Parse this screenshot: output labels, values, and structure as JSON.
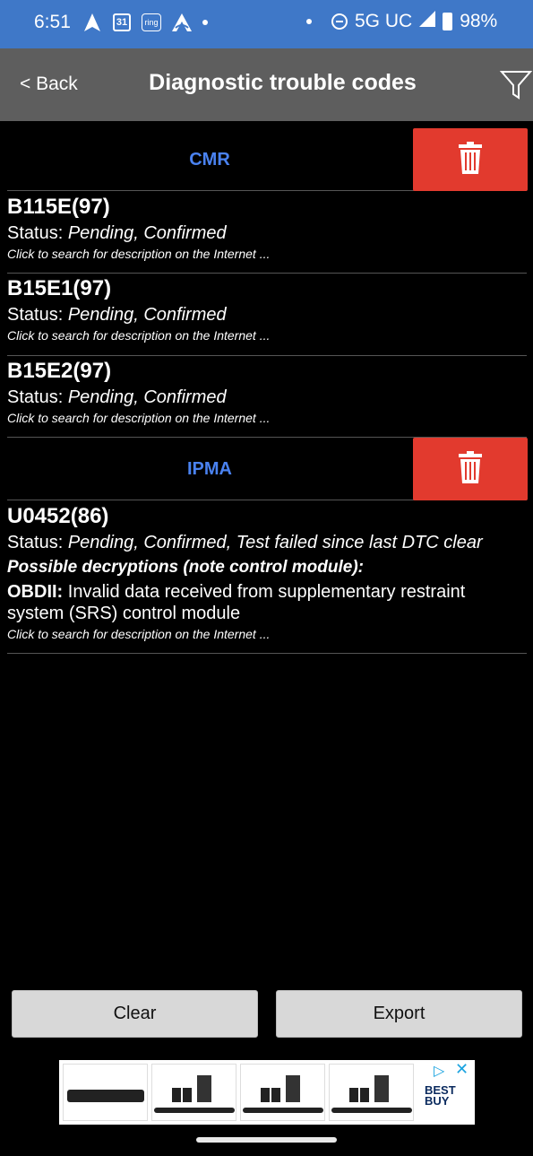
{
  "status_bar": {
    "time": "6:51",
    "calendar": "31",
    "ring": "ring",
    "network": "5G UC",
    "battery": "98%"
  },
  "header": {
    "back_label": "< Back",
    "title": "Diagnostic trouble codes"
  },
  "sections": [
    {
      "name": "CMR",
      "codes": [
        {
          "code": "B115E(97)",
          "status_label": "Status:",
          "status_value": "Pending, Confirmed",
          "hint": "Click to search for description on the Internet ..."
        },
        {
          "code": "B15E1(97)",
          "status_label": "Status:",
          "status_value": "Pending, Confirmed",
          "hint": "Click to search for description on the Internet ..."
        },
        {
          "code": "B15E2(97)",
          "status_label": "Status:",
          "status_value": "Pending, Confirmed",
          "hint": "Click to search for description on the Internet ..."
        }
      ]
    },
    {
      "name": "IPMA",
      "codes": [
        {
          "code": "U0452(86)",
          "status_label": "Status:",
          "status_value": "Pending, Confirmed, Test failed since last DTC clear",
          "possible_label": "Possible decryptions (note control module):",
          "obd_label": "OBDII:",
          "obd_text": " Invalid data received from supplementary restraint system (SRS) control module",
          "hint": "Click to search for description on the Internet ..."
        }
      ]
    }
  ],
  "buttons": {
    "clear": "Clear",
    "export": "Export"
  },
  "ad": {
    "brand_line1": "BEST",
    "brand_line2": "BUY"
  },
  "colors": {
    "status_bar": "#3f78c8",
    "app_bar": "#5e5e5e",
    "section_name": "#4a82f0",
    "delete": "#e23a2e"
  }
}
